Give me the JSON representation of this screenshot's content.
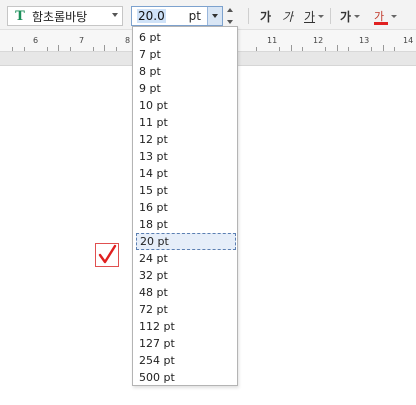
{
  "toolbar": {
    "font_name": "함초롬바탕",
    "font_icon": "font-t-icon",
    "font_size_value": "20.0",
    "font_size_unit": "pt",
    "format_buttons": [
      {
        "label": "가",
        "style": "bold"
      },
      {
        "label": "가",
        "style": "italic"
      },
      {
        "label": "가",
        "style": "underline"
      },
      {
        "label": "가",
        "style": "strikethrough"
      },
      {
        "label": "가",
        "style": "font-color"
      }
    ],
    "font_color": "#e02020"
  },
  "ruler": {
    "numbers": [
      "6",
      "7",
      "8",
      "11",
      "12",
      "13",
      "14"
    ]
  },
  "font_size_options": [
    "6 pt",
    "7 pt",
    "8 pt",
    "9 pt",
    "10 pt",
    "11 pt",
    "12 pt",
    "13 pt",
    "14 pt",
    "15 pt",
    "16 pt",
    "18 pt",
    "20 pt",
    "24 pt",
    "32 pt",
    "48 pt",
    "72 pt",
    "112 pt",
    "127 pt",
    "254 pt",
    "500 pt"
  ],
  "selected_option": "20 pt",
  "colors": {
    "selection_border": "#5b7fb2",
    "checkmark": "#e02020"
  }
}
